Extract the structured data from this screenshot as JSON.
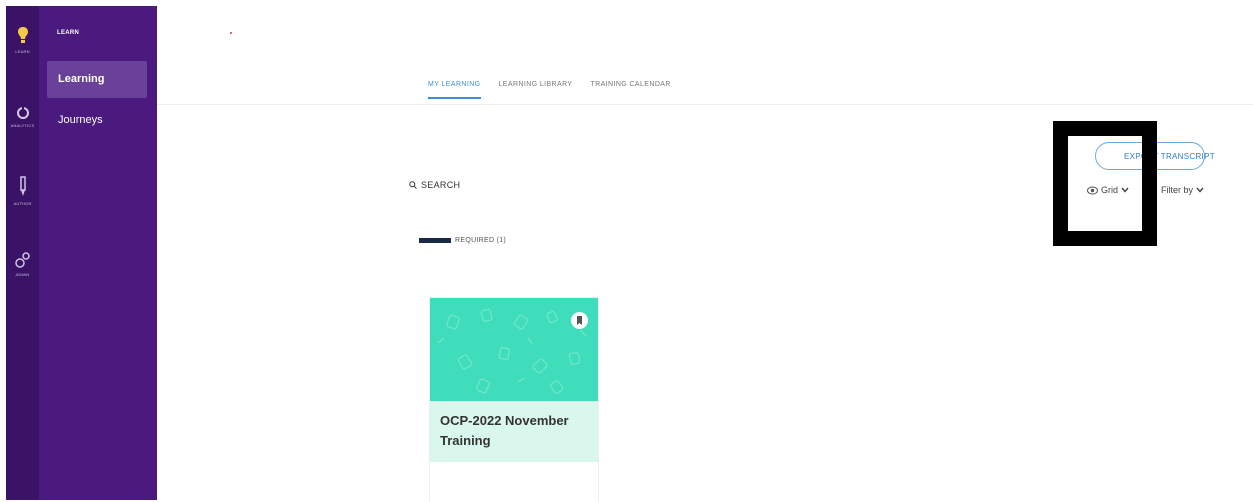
{
  "rail": [
    {
      "label": "LEARN",
      "icon": "lightbulb-icon"
    },
    {
      "label": "ANALYTICS",
      "icon": "analytics-icon"
    },
    {
      "label": "AUTHOR",
      "icon": "author-pen-icon"
    },
    {
      "label": "ADMIN",
      "icon": "admin-gear-icon"
    }
  ],
  "sidebar": {
    "heading": "LEARN",
    "items": [
      {
        "label": "Learning",
        "active": true
      },
      {
        "label": "Journeys",
        "active": false
      }
    ]
  },
  "tabs": [
    {
      "label": "MY LEARNING",
      "active": true
    },
    {
      "label": "LEARNING LIBRARY",
      "active": false
    },
    {
      "label": "TRAINING CALENDAR",
      "active": false
    }
  ],
  "toolbar": {
    "export_label": "EXPORT TRANSCRIPT",
    "view_label": "Grid",
    "filter_label": "Filter by"
  },
  "search": {
    "label": "SEARCH"
  },
  "required": {
    "label": "REQUIRED (1)"
  },
  "cards": [
    {
      "title": "OCP-2022 November Training"
    }
  ],
  "colors": {
    "rail_bg": "#3a1266",
    "sidebar_bg": "#4b1a7e",
    "accent": "#3a8fd8",
    "card_banner": "#3fddbb",
    "card_title_bg": "#daf7ee"
  }
}
